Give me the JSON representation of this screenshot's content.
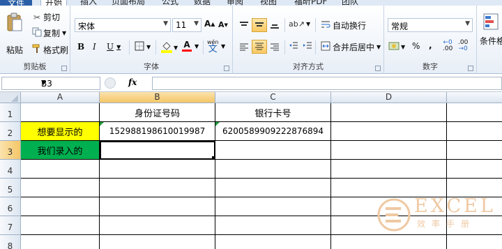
{
  "ribbon": {
    "tabs": [
      "文件",
      "开始",
      "插入",
      "页面布局",
      "公式",
      "数据",
      "审阅",
      "视图",
      "福昕PDF",
      "团队"
    ],
    "clipboard": {
      "paste": "粘贴",
      "cut": "剪切",
      "copy": "复制",
      "format_painter": "格式刷",
      "group_label": "剪贴板"
    },
    "font": {
      "font_name": "宋体",
      "font_size": "11",
      "grow": "A",
      "shrink": "A",
      "bold": "B",
      "italic": "I",
      "underline": "U",
      "phonetic": "wén",
      "group_label": "字体",
      "accent_fill": "#ffff00",
      "accent_text": "#ff0000"
    },
    "alignment": {
      "wrap_text": "自动换行",
      "merge_center": "合并后居中",
      "group_label": "对齐方式"
    },
    "number": {
      "format": "常规",
      "percent": "%",
      "comma": ",",
      "inc_decimal": ".00",
      "dec_decimal": ".00",
      "group_label": "数字"
    },
    "styles": {
      "conditional": "条件格"
    }
  },
  "formula_bar": {
    "name_box": "B3",
    "fx": "fx",
    "value": ""
  },
  "grid": {
    "columns": [
      "A",
      "B",
      "C",
      "D"
    ],
    "rows": [
      "1",
      "2",
      "3",
      "4",
      "5",
      "6",
      "7",
      "8"
    ],
    "cells": {
      "B1": "身份证号码",
      "C1": "银行卡号",
      "A2": "想要显示的",
      "B2": "152988198610019987",
      "C2": "6200589909222876894",
      "A3": "我们录入的"
    },
    "colors": {
      "yellow": "#ffff00",
      "green": "#00b050",
      "selection": "#f4c667"
    }
  },
  "watermark": {
    "title": "EXCEL",
    "subtitle": "效率手册"
  }
}
